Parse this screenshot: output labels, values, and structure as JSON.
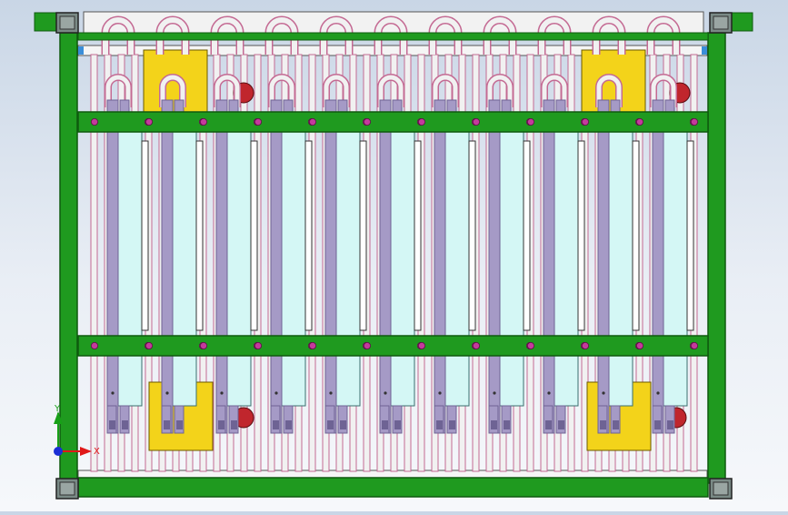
{
  "app": {
    "view": "cad-model-viewport",
    "description_visible_text": "none"
  },
  "colors": {
    "frame": "#1f9a1f",
    "frame_dark": "#0f5a0f",
    "tube_fill": "#f1f1f1",
    "tube_stroke": "#c46a93",
    "electrode": "#a59ac6",
    "electrode_dark": "#6e6394",
    "cell_fill": "#d4f7f5",
    "bracket": "#f3d31a",
    "red_knob": "#c0262d",
    "bolt": "#c43a9c",
    "corner": "#7a8a86"
  },
  "triad": {
    "x_label": "X",
    "y_label": "Y",
    "x_color": "#e01818",
    "y_color": "#18a018",
    "z_color": "#1a2fd6"
  },
  "model": {
    "modules": 11,
    "bolts_per_bar": 11
  }
}
